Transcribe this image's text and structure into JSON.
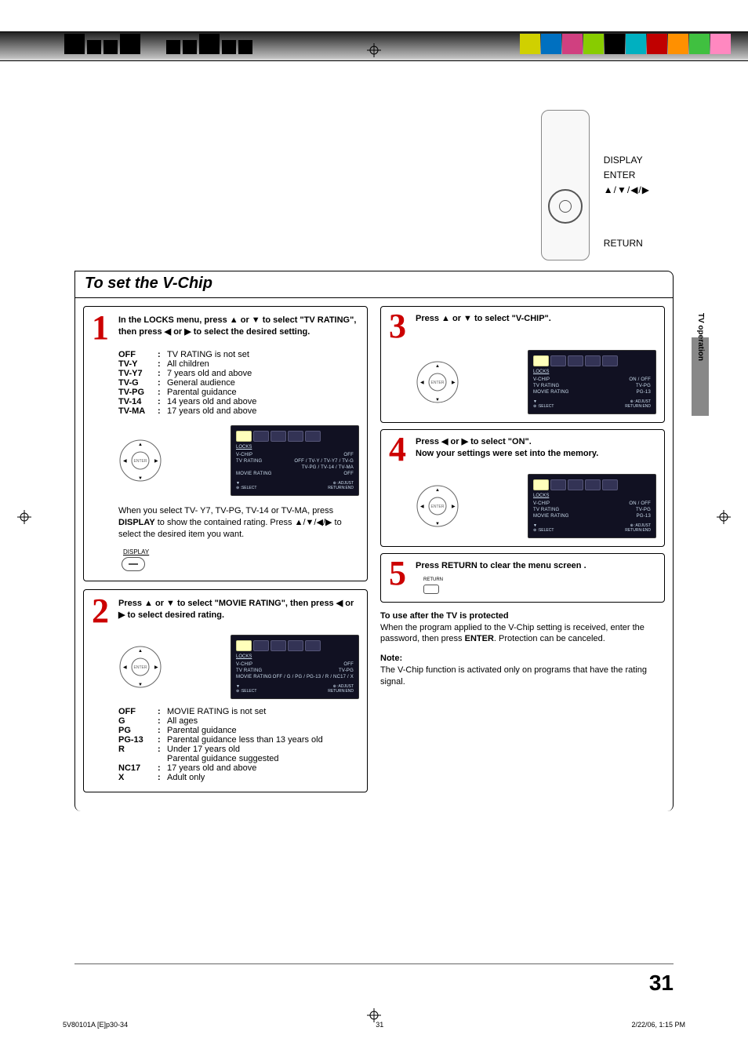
{
  "topbar_colors": [
    "#d0d000",
    "#0070c0",
    "#d04080",
    "#88cc00",
    "#000000",
    "#00b0c0",
    "#c00000",
    "#ff9000",
    "#40c040",
    "#ff88c0"
  ],
  "remote_labels": {
    "display": "DISPLAY",
    "enter": "ENTER",
    "arrows": "▲/▼/◀/▶",
    "return": "RETURN"
  },
  "side_tab_label": "TV operation",
  "section_title": "To set the V-Chip",
  "step1": {
    "num": "1",
    "text_a": "In the LOCKS menu, press ▲ or ▼  to select \"TV RATING\", then press  ◀ or ▶ to select the desired setting.",
    "defs": [
      {
        "k": "OFF",
        "v": "TV RATING is not set"
      },
      {
        "k": "TV-Y",
        "v": "All children"
      },
      {
        "k": "TV-Y7",
        "v": "7 years old and above"
      },
      {
        "k": "TV-G",
        "v": "General audience"
      },
      {
        "k": "TV-PG",
        "v": "Parental guidance"
      },
      {
        "k": "TV-14",
        "v": "14 years old and above"
      },
      {
        "k": "TV-MA",
        "v": "17 years old and above"
      }
    ],
    "para_a": "When you select TV- Y7, TV-PG, TV-14 or TV-MA, press ",
    "para_b": "DISPLAY",
    "para_c": " to show the contained rating. Press ▲/▼/◀/▶  to select the desired item you want.",
    "disp_label": "DISPLAY",
    "osd": {
      "title": "LOCKS",
      "lines": [
        {
          "l": "V-CHIP",
          "r": "OFF"
        },
        {
          "l": "TV RATING",
          "r": "OFF / TV-Y / TV-Y7 / TV-G"
        },
        {
          "l": "",
          "r": "TV-PG / TV-14 / TV-MA"
        },
        {
          "l": "MOVIE RATING",
          "r": "OFF"
        }
      ],
      "foot": {
        "l": "▼\n⊕ :SELECT",
        "r": "⊕ :ADJUST\nRETURN:END"
      }
    }
  },
  "step2": {
    "num": "2",
    "text": "Press ▲ or ▼ to select \"MOVIE RATING\", then press ◀ or ▶ to select desired rating.",
    "defs": [
      {
        "k": "OFF",
        "v": "MOVIE RATING is not set"
      },
      {
        "k": "G",
        "v": "All ages"
      },
      {
        "k": "PG",
        "v": "Parental guidance"
      },
      {
        "k": "PG-13",
        "v": "Parental guidance less than 13 years old"
      },
      {
        "k": "R",
        "v": "Under 17 years old"
      },
      {
        "k": "",
        "v": "Parental guidance suggested"
      },
      {
        "k": "NC17",
        "v": "17 years old and above"
      },
      {
        "k": "X",
        "v": "Adult only"
      }
    ],
    "osd": {
      "title": "LOCKS",
      "lines": [
        {
          "l": "V-CHIP",
          "r": "OFF"
        },
        {
          "l": "TV RATING",
          "r": "TV-PG"
        },
        {
          "l": "MOVIE RATING",
          "r": "OFF / G / PG / PG-13 / R / NC17 / X"
        }
      ],
      "foot": {
        "l": "▼\n⊕ :SELECT",
        "r": "⊕ :ADJUST\nRETURN:END"
      }
    }
  },
  "step3": {
    "num": "3",
    "text": "Press ▲ or ▼  to select \"V-CHIP\".",
    "osd": {
      "title": "LOCKS",
      "lines": [
        {
          "l": "V-CHIP",
          "r": "ON / OFF"
        },
        {
          "l": "TV RATING",
          "r": "TV-PG"
        },
        {
          "l": "MOVIE RATING",
          "r": "PG-13"
        }
      ],
      "foot": {
        "l": "▼\n⊕ :SELECT",
        "r": "⊕ :ADJUST\nRETURN:END"
      }
    }
  },
  "step4": {
    "num": "4",
    "text_a": "Press ◀ or ▶ to select \"ON\".",
    "text_b": "Now your settings were set into the memory.",
    "osd": {
      "title": "LOCKS",
      "lines": [
        {
          "l": "V-CHIP",
          "r": "ON / OFF"
        },
        {
          "l": "TV RATING",
          "r": "TV-PG"
        },
        {
          "l": "MOVIE RATING",
          "r": "PG-13"
        }
      ],
      "foot": {
        "l": "▼\n⊕ :SELECT",
        "r": "⊕ :ADJUST\nRETURN:END"
      }
    }
  },
  "step5": {
    "num": "5",
    "text": "Press RETURN to clear the menu screen .",
    "btn_label": "RETURN"
  },
  "after": {
    "hdr": "To use after the TV is protected",
    "body_a": "When the program applied to the V-Chip setting is received, enter the password, then press ",
    "body_b": "ENTER",
    "body_c": ". Protection can be canceled.",
    "note_hdr": "Note:",
    "note_body": "The V-Chip function is activated only on programs that have the rating signal."
  },
  "page_number": "31",
  "footer": {
    "left": "5V80101A [E]p30-34",
    "mid": "31",
    "right": "2/22/06, 1:15 PM"
  }
}
